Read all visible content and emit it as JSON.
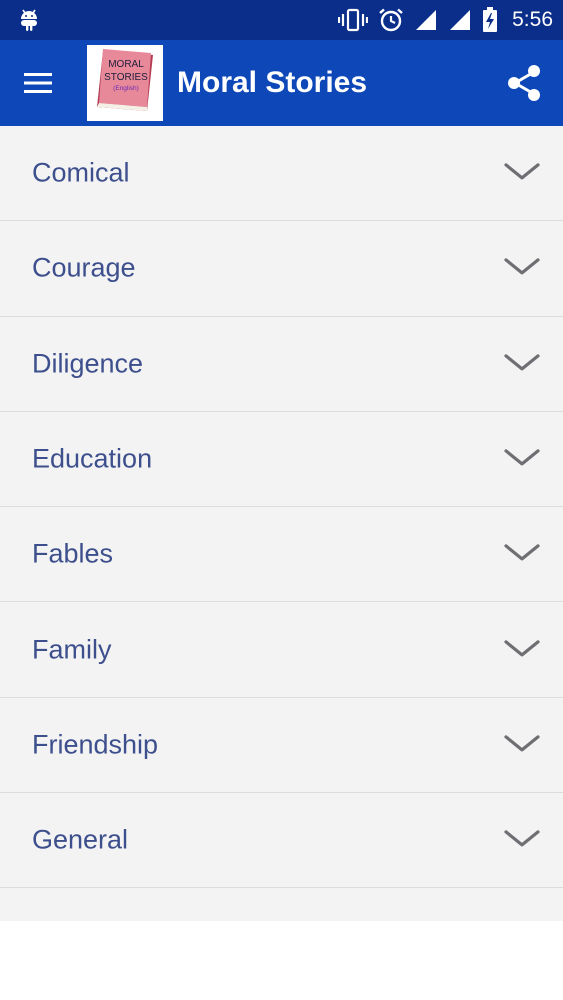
{
  "status_bar": {
    "time": "5:56",
    "icons": [
      "android-icon",
      "vibrate-icon",
      "alarm-icon",
      "signal-icon",
      "signal-icon",
      "battery-charging-icon"
    ]
  },
  "app_bar": {
    "title": "Moral Stories",
    "logo": {
      "line1": "MORAL",
      "line2": "STORIES",
      "line3": "(English)"
    },
    "menu_icon": "hamburger-menu-icon",
    "share_icon": "share-icon"
  },
  "categories": [
    {
      "label": "Comical"
    },
    {
      "label": "Courage"
    },
    {
      "label": "Diligence"
    },
    {
      "label": "Education"
    },
    {
      "label": "Fables"
    },
    {
      "label": "Family"
    },
    {
      "label": "Friendship"
    },
    {
      "label": "General"
    }
  ],
  "colors": {
    "status_bar": "#0a2e8a",
    "app_bar": "#0d47b8",
    "list_background": "#f3f3f4",
    "label_text": "#3d4f8c",
    "chevron": "#6f6f73",
    "logo_book": "#e8899a"
  }
}
